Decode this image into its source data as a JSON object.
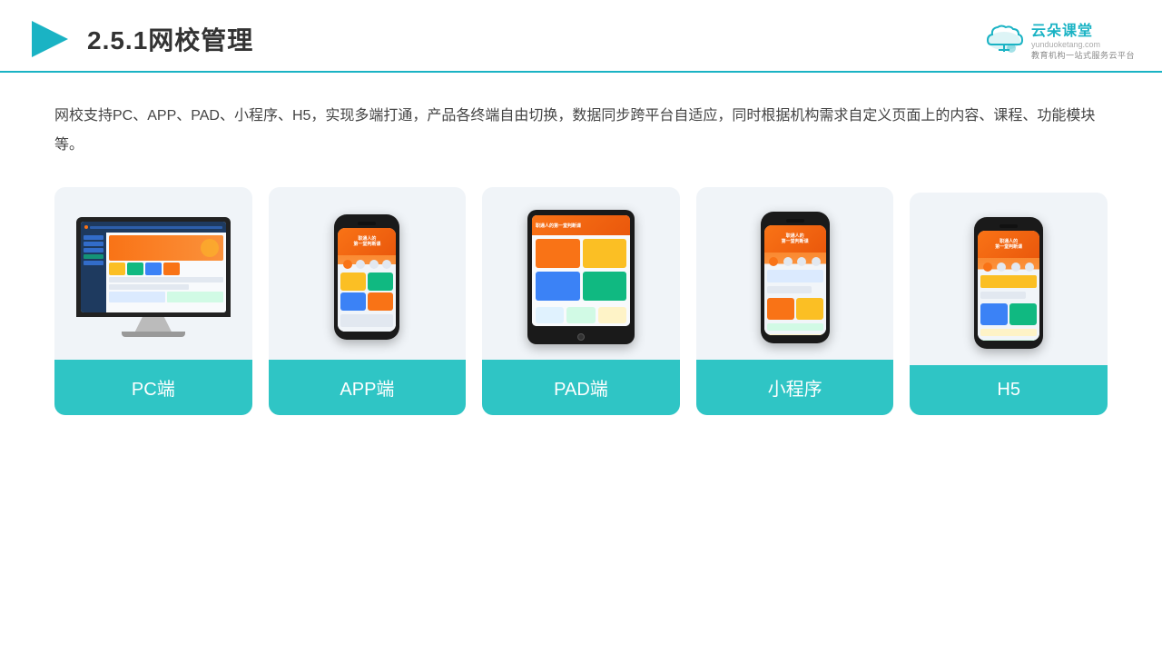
{
  "header": {
    "title": "2.5.1网校管理",
    "brand_name": "云朵课堂",
    "brand_sub": "教育机构一站式服务云平台",
    "brand_url": "yunduoketang.com"
  },
  "description": "网校支持PC、APP、PAD、小程序、H5，实现多端打通，产品各终端自由切换，数据同步跨平台自适应，同时根据机构需求自定义页面上的内容、课程、功能模块等。",
  "cards": [
    {
      "id": "pc",
      "label": "PC端"
    },
    {
      "id": "app",
      "label": "APP端"
    },
    {
      "id": "pad",
      "label": "PAD端"
    },
    {
      "id": "miniprogram",
      "label": "小程序"
    },
    {
      "id": "h5",
      "label": "H5"
    }
  ],
  "colors": {
    "teal": "#2fc5c5",
    "accent": "#f97316",
    "dark_blue": "#1e3a5f"
  }
}
